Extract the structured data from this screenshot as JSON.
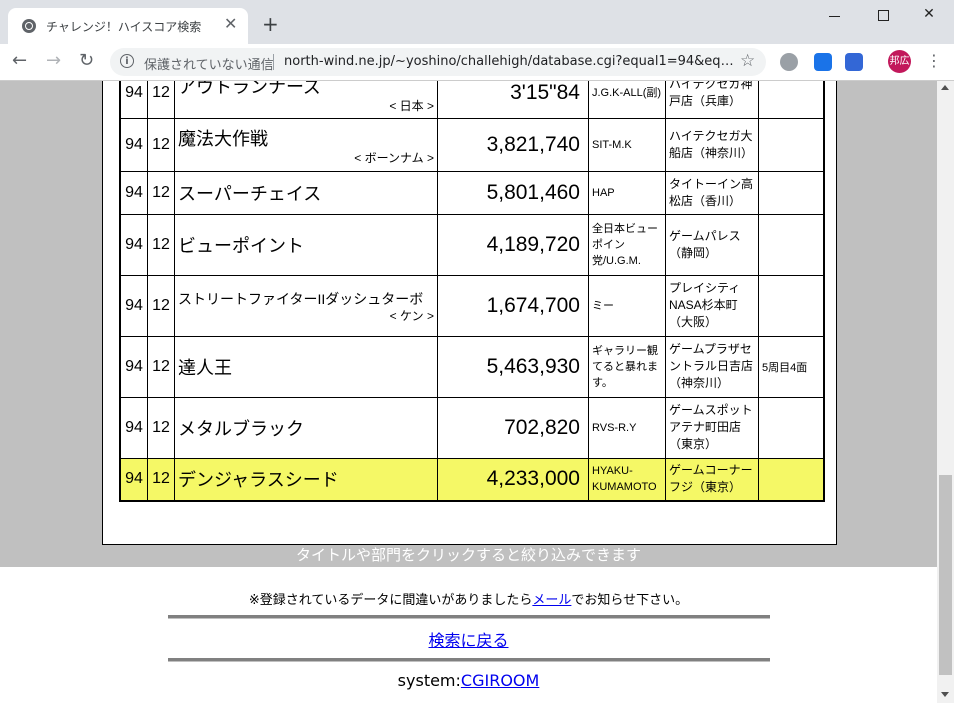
{
  "browser": {
    "tab_title": "チャレンジ！ハイスコア検索",
    "tab_close": "✕",
    "new_tab": "+",
    "security_label": "保護されていない通信",
    "url": "north-wind.ne.jp/~yoshino/challehigh/database.cgi?equal1=94&equa...",
    "profile_initials": "邦広"
  },
  "table": {
    "rows": [
      {
        "year": "94",
        "month": "12",
        "title": "アウトランナーズ",
        "sub": "< 日本 >",
        "score": "3'15\"84",
        "name": "J.G.K-ALL(副)",
        "store": "ハイテクセガ神戸店（兵庫）",
        "note": "",
        "highlight": false
      },
      {
        "year": "94",
        "month": "12",
        "title": "魔法大作戦",
        "sub": "< ボーンナム >",
        "score": "3,821,740",
        "name": "SIT-M.K",
        "store": "ハイテクセガ大船店（神奈川）",
        "note": "",
        "highlight": false
      },
      {
        "year": "94",
        "month": "12",
        "title": "スーパーチェイス",
        "sub": "",
        "score": "5,801,460",
        "name": "HAP",
        "store": "タイトーイン高松店（香川）",
        "note": "",
        "highlight": false
      },
      {
        "year": "94",
        "month": "12",
        "title": "ビューポイント",
        "sub": "",
        "score": "4,189,720",
        "name": "全日本ビューポイン党/U.G.M.",
        "store": "ゲームパレス（静岡）",
        "note": "",
        "highlight": false
      },
      {
        "year": "94",
        "month": "12",
        "title": "ストリートファイターIIダッシュターボ",
        "sub": "< ケン >",
        "score": "1,674,700",
        "name": "ミー",
        "store": "プレイシティNASA杉本町（大阪）",
        "note": "",
        "highlight": false
      },
      {
        "year": "94",
        "month": "12",
        "title": "達人王",
        "sub": "",
        "score": "5,463,930",
        "name": "ギャラリー観てると暴れます。",
        "store": "ゲームプラザセントラル日吉店（神奈川）",
        "note": "5周目4面",
        "highlight": false
      },
      {
        "year": "94",
        "month": "12",
        "title": "メタルブラック",
        "sub": "",
        "score": "702,820",
        "name": "RVS-R.Y",
        "store": "ゲームスポットアテナ町田店（東京）",
        "note": "",
        "highlight": false
      },
      {
        "year": "94",
        "month": "12",
        "title": "デンジャラスシード",
        "sub": "",
        "score": "4,233,000",
        "name": "HYAKU-KUMAMOTO",
        "store": "ゲームコーナーフジ（東京）",
        "note": "",
        "highlight": true
      }
    ]
  },
  "footer": {
    "filter_hint": "タイトルや部門をクリックすると絞り込みできます",
    "notice_before": "※登録されているデータに間違いがありましたら",
    "notice_link": "メール",
    "notice_after": "でお知らせ下さい。",
    "back_link": "検索に戻る",
    "system_label": "system:",
    "system_link": "CGIROOM"
  },
  "colors": {
    "highlight_row": "#f5f866",
    "gray_band": "#c0c0c0",
    "link": "#0000ee"
  }
}
